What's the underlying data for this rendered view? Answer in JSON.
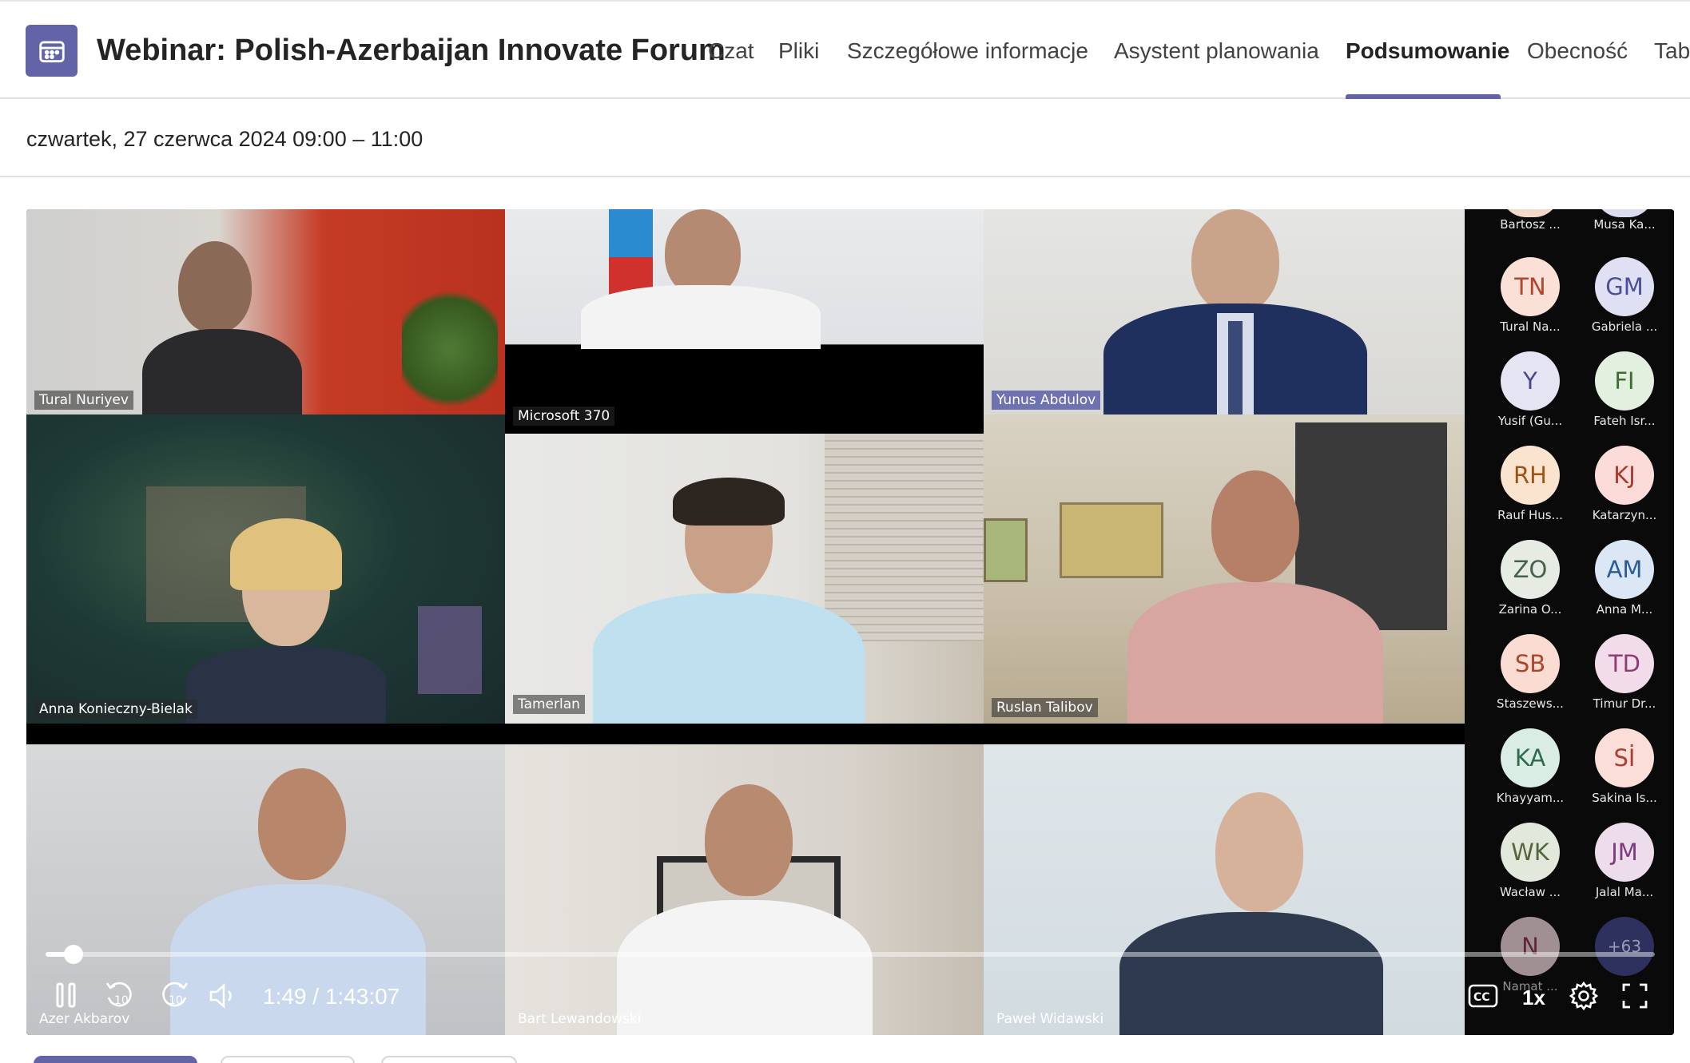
{
  "header": {
    "title": "Webinar: Polish-Azerbaijan Innovate Forum",
    "tabs": [
      {
        "label": "Czat",
        "active": false
      },
      {
        "label": "Pliki",
        "active": false
      },
      {
        "label": "Szczegółowe informacje",
        "active": false
      },
      {
        "label": "Asystent planowania",
        "active": false
      },
      {
        "label": "Podsumowanie",
        "active": true
      },
      {
        "label": "Obecność",
        "active": false
      },
      {
        "label": "Tabl",
        "active": false
      }
    ],
    "accent_color": "#6264a7"
  },
  "meeting": {
    "date_time": "czwartek, 27 czerwca 2024 09:00 – 11:00"
  },
  "video": {
    "tiles": [
      {
        "name": "Tural Nuriyev"
      },
      {
        "name": "Microsoft 370"
      },
      {
        "name": "Yunus Abdulov"
      },
      {
        "name": "Anna Konieczny-Bielak"
      },
      {
        "name": "Tamerlan"
      },
      {
        "name": "Ruslan Talibov"
      },
      {
        "name": "Azer Akbarov"
      },
      {
        "name": "Bart Lewandowski"
      },
      {
        "name": "Paweł Widawski"
      }
    ],
    "roster": [
      {
        "initials": "",
        "name": "Bartosz ...",
        "bg": "#f3d9c9",
        "fg": "#8a4b2b"
      },
      {
        "initials": "",
        "name": "Musa Ka...",
        "bg": "#dcdcf0",
        "fg": "#4a4a8a"
      },
      {
        "initials": "TN",
        "name": "Tural Na...",
        "bg": "#fbe0d8",
        "fg": "#b0462a"
      },
      {
        "initials": "GM",
        "name": "Gabriela ...",
        "bg": "#dfe0f3",
        "fg": "#4b4e9a"
      },
      {
        "initials": "Y",
        "name": "Yusif (Gu...",
        "bg": "#e4e4f2",
        "fg": "#45468c"
      },
      {
        "initials": "FI",
        "name": "Fateh Isr...",
        "bg": "#e3efdf",
        "fg": "#3f6c34"
      },
      {
        "initials": "RH",
        "name": "Rauf Hus...",
        "bg": "#fbe4cf",
        "fg": "#9c5415"
      },
      {
        "initials": "KJ",
        "name": "Katarzyn...",
        "bg": "#fbdcd8",
        "fg": "#a83b31"
      },
      {
        "initials": "ZO",
        "name": "Zarina O...",
        "bg": "#e6ece4",
        "fg": "#46614a"
      },
      {
        "initials": "AM",
        "name": "Anna M...",
        "bg": "#dbe7f5",
        "fg": "#2b5c94"
      },
      {
        "initials": "SB",
        "name": "Staszews...",
        "bg": "#fbdcd3",
        "fg": "#b0442a"
      },
      {
        "initials": "TD",
        "name": "Timur Dr...",
        "bg": "#f2dcea",
        "fg": "#8f3b73"
      },
      {
        "initials": "KA",
        "name": "Khayyam...",
        "bg": "#d9ede4",
        "fg": "#2e6b4d"
      },
      {
        "initials": "Sİ",
        "name": "Sakina Is...",
        "bg": "#fbded8",
        "fg": "#ad3f33"
      },
      {
        "initials": "WK",
        "name": "Wacław ...",
        "bg": "#e3e8dc",
        "fg": "#55663c"
      },
      {
        "initials": "JM",
        "name": "Jalal Ma...",
        "bg": "#eddcec",
        "fg": "#7d3a7a"
      },
      {
        "initials": "N",
        "name": "Namat ...",
        "bg": "#f1d8de",
        "fg": "#8f3552"
      },
      {
        "initials": "+63",
        "name": "",
        "bg": "#3a3f7a",
        "fg": "#c8cbf0"
      }
    ],
    "player": {
      "time_display": "1:49 / 1:43:07",
      "progress": 0.0176,
      "speed": "1x",
      "icons": [
        "pause-icon",
        "rewind-10-icon",
        "forward-10-icon",
        "volume-icon",
        "captions-icon",
        "settings-icon",
        "fullscreen-icon"
      ],
      "skip_seconds": "10",
      "cc_label": "CC"
    }
  }
}
